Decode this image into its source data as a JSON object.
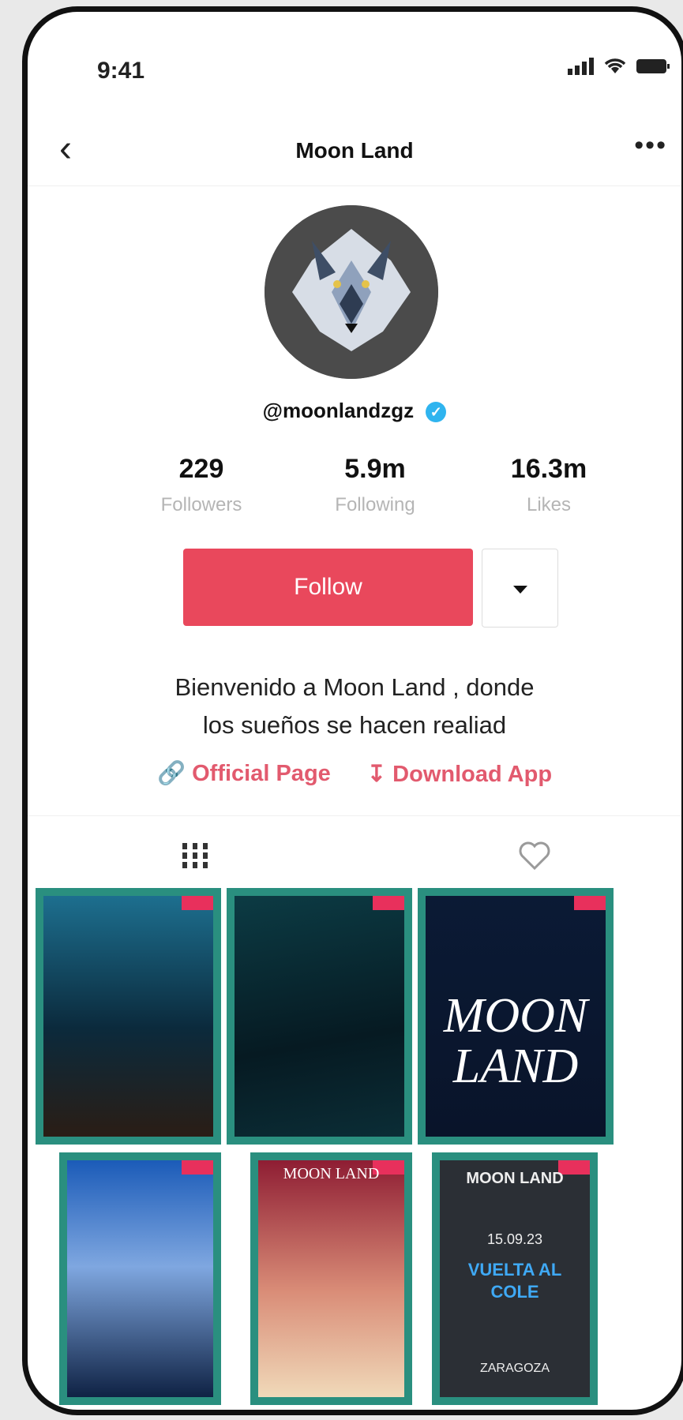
{
  "status": {
    "time": "9:41"
  },
  "nav": {
    "title": "Moon Land"
  },
  "profile": {
    "handle": "@moonlandzgz"
  },
  "stats": [
    {
      "value": "229",
      "label": "Followers"
    },
    {
      "value": "5.9m",
      "label": "Following"
    },
    {
      "value": "16.3m",
      "label": "Likes"
    }
  ],
  "actions": {
    "follow": "Follow"
  },
  "bio": {
    "line1": "Bienvenido a Moon Land , donde",
    "line2": "los sueños se hacen realiad"
  },
  "links": {
    "official": "Official Page",
    "download": "Download App"
  },
  "grid": {
    "moon_title_1": "MOON",
    "moon_title_2": "LAND",
    "poster_header": "MOON LAND",
    "date": "15.09.23",
    "event": "VUELTA AL COLE",
    "city": "ZARAGOZA"
  },
  "colors": {
    "accent": "#e9485c",
    "verified": "#2fb4ef",
    "frame": "#2a8f7f"
  }
}
